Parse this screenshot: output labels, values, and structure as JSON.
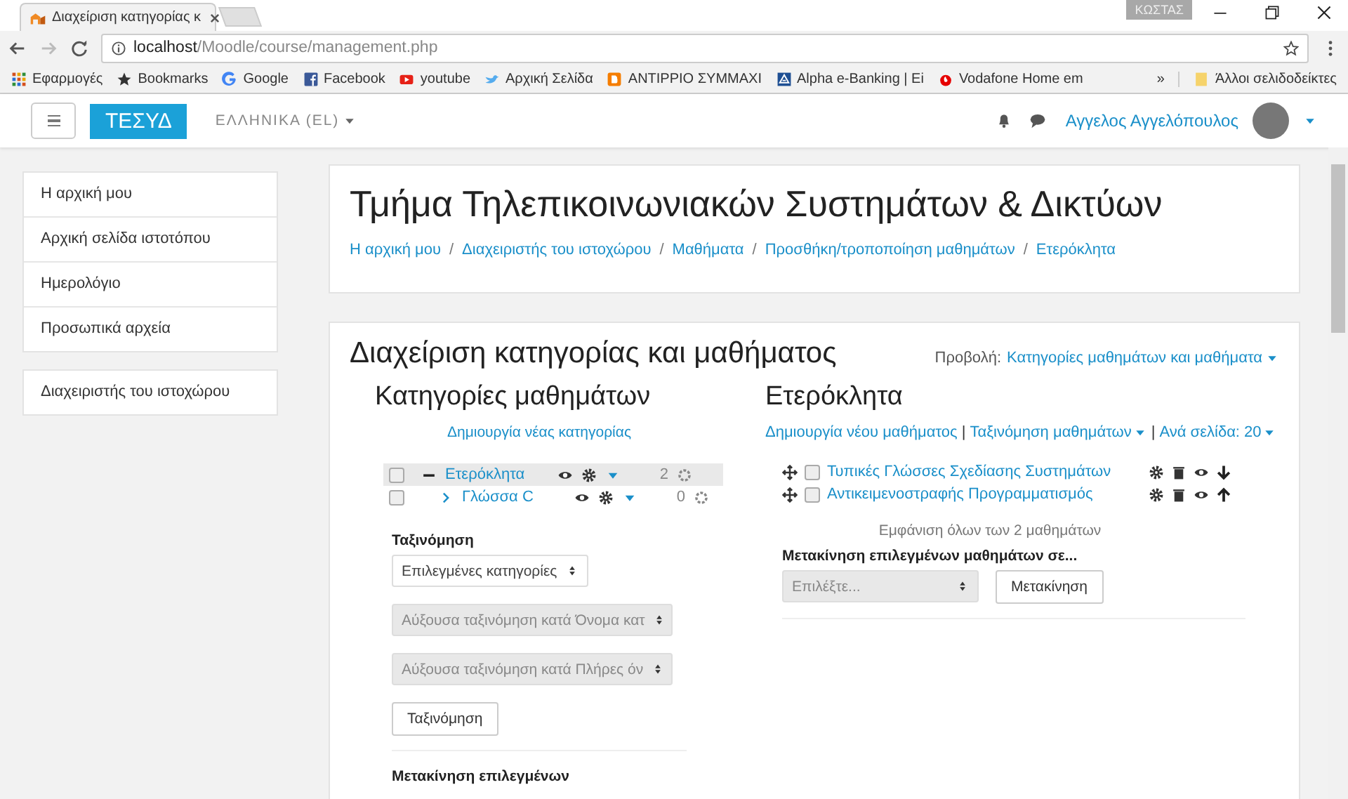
{
  "browser": {
    "tab_title": "Διαχείριση κατηγορίας κ",
    "profile": "ΚΩΣΤΑΣ",
    "url_host": "localhost",
    "url_path": "/Moodle/course/management.php",
    "bookmarks": [
      {
        "label": "Εφαρμογές",
        "kind": "apps"
      },
      {
        "label": "Bookmarks",
        "kind": "star"
      },
      {
        "label": "Google",
        "kind": "g"
      },
      {
        "label": "Facebook",
        "kind": "f"
      },
      {
        "label": "youtube",
        "kind": "play"
      },
      {
        "label": "Αρχική Σελίδα",
        "kind": "bird"
      },
      {
        "label": "ΑΝΤΙΡΡΙΟ ΣΥΜΜΑΧΙ",
        "kind": "b"
      },
      {
        "label": "Alpha e-Banking | Ei",
        "kind": "bank"
      },
      {
        "label": "Vodafone Home em",
        "kind": "drop"
      }
    ],
    "more": "»",
    "other_bookmarks": "Άλλοι σελιδοδείκτες"
  },
  "navbar": {
    "brand": "ΤΕΣΥΔ",
    "language": "ΕΛΛΗΝΙΚΑ (EL)",
    "user": "Αγγελος Αγγελόπουλος"
  },
  "sidebar": {
    "groups": [
      [
        {
          "label": "Η αρχική μου"
        },
        {
          "label": "Αρχική σελίδα ιστοτόπου"
        },
        {
          "label": "Ημερολόγιο"
        },
        {
          "label": "Προσωπικά αρχεία"
        }
      ],
      [
        {
          "label": "Διαχειριστής του ιστοχώρου"
        }
      ]
    ]
  },
  "header": {
    "title": "Τμήμα Τηλεπικοινωνιακών Συστημάτων & Δικτύων",
    "separator": "/",
    "breadcrumbs": [
      "Η αρχική μου",
      "Διαχειριστής του ιστοχώρου",
      "Μαθήματα",
      "Προσθήκη/τροποποίηση μαθημάτων",
      "Ετερόκλητα"
    ]
  },
  "management": {
    "title": "Διαχείριση κατηγορίας και μαθήματος",
    "view_label": "Προβολή:",
    "view_value": "Κατηγορίες μαθημάτων και μαθήματα",
    "categories": {
      "title": "Κατηγορίες μαθημάτων",
      "create_link": "Δημιουργία νέας κατηγορίας",
      "items": [
        {
          "name": "Ετερόκλητα",
          "count": "2",
          "checked": false,
          "selected": true,
          "expanded": true,
          "children": [
            {
              "name": "Γλώσσα C",
              "count": "0",
              "checked": false,
              "selected": false,
              "expanded": false
            }
          ]
        }
      ],
      "sort_label": "Ταξινόμηση",
      "sort_selects": [
        {
          "value": "Επιλεγμένες κατηγορίες",
          "disabled": false
        },
        {
          "value": "Αύξουσα ταξινόμηση κατά Όνομα κατ",
          "disabled": true
        },
        {
          "value": "Αύξουσα ταξινόμηση κατά Πλήρες όν",
          "disabled": true
        }
      ],
      "sort_button": "Ταξινόμηση",
      "move_label": "Μετακίνηση επιλεγμένων"
    },
    "courses": {
      "title": "Ετερόκλητα",
      "separator": "|",
      "links": [
        {
          "label": "Δημιουργία νέου μαθήματος",
          "dropdown": false
        },
        {
          "label": "Ταξινόμηση μαθημάτων",
          "dropdown": true
        },
        {
          "label": "Ανά σελίδα: 20",
          "dropdown": true
        }
      ],
      "items": [
        {
          "name": "Τυπικές Γλώσσες Σχεδίασης Συστημάτων",
          "checked": false,
          "kind": "down"
        },
        {
          "name": "Αντικειμενοστραφής Προγραμματισμός",
          "checked": false,
          "kind": "up"
        }
      ],
      "summary": "Εμφάνιση όλων των 2 μαθημάτων",
      "move_label": "Μετακίνηση επιλεγμένων μαθημάτων σε...",
      "move_placeholder": "Επιλέξτε...",
      "move_button": "Μετακίνηση"
    }
  }
}
